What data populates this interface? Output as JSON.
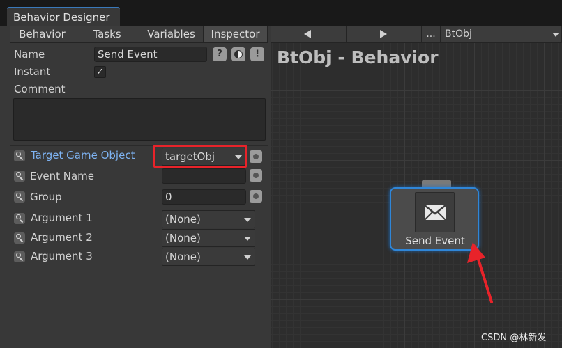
{
  "window": {
    "title": "Behavior Designer"
  },
  "tabs": [
    "Behavior",
    "Tasks",
    "Variables",
    "Inspector"
  ],
  "inspector": {
    "name_label": "Name",
    "name_value": "Send Event",
    "instant_label": "Instant",
    "instant_checked": "✓",
    "comment_label": "Comment",
    "help_glyph": "?",
    "menu_glyph": "⋮",
    "fields": [
      {
        "label": "Target Game Object",
        "value": "targetObj"
      },
      {
        "label": "Event Name",
        "value": ""
      },
      {
        "label": "Group",
        "value": "0"
      },
      {
        "label": "Argument 1",
        "value": "(None)"
      },
      {
        "label": "Argument 2",
        "value": "(None)"
      },
      {
        "label": "Argument 3",
        "value": "(None)"
      }
    ]
  },
  "graph": {
    "toolbar": {
      "more": "...",
      "behavior_select": "BtObj"
    },
    "title": "BtObj - Behavior",
    "node": {
      "label": "Send Event",
      "icon": "envelope-icon"
    }
  },
  "watermark": "CSDN @林新发",
  "colors": {
    "accent": "#3a79bb",
    "highlight": "#e8232a",
    "link_label": "#7eb3f2"
  }
}
